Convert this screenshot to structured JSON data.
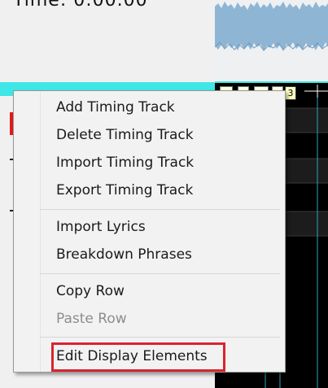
{
  "time_panel": {
    "label": "Time: 0:00.00"
  },
  "row_marker": {
    "number": "3"
  },
  "context_menu": {
    "groups": [
      {
        "items": [
          {
            "label": "Add Timing Track",
            "enabled": true
          },
          {
            "label": "Delete Timing Track",
            "enabled": true
          },
          {
            "label": "Import Timing Track",
            "enabled": true
          },
          {
            "label": "Export Timing Track",
            "enabled": true
          }
        ]
      },
      {
        "items": [
          {
            "label": "Import Lyrics",
            "enabled": true
          },
          {
            "label": "Breakdown Phrases",
            "enabled": true
          }
        ]
      },
      {
        "items": [
          {
            "label": "Copy Row",
            "enabled": true
          },
          {
            "label": "Paste Row",
            "enabled": false
          }
        ]
      },
      {
        "items": [
          {
            "label": "Edit Display Elements",
            "enabled": true,
            "highlighted": true
          }
        ]
      }
    ]
  },
  "colors": {
    "waveform_fill": "#8fb5d4",
    "selected_row": "#3ee6e6",
    "highlight_border": "#d9242f",
    "grid_background": "#000000"
  }
}
